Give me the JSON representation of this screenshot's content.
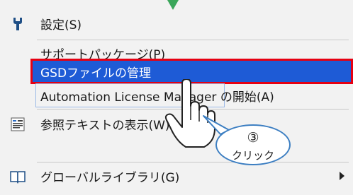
{
  "menu": {
    "items": [
      {
        "label": "設定(S)",
        "icon": "wrench-icon"
      },
      {
        "label": "サポートパッケージ(P)"
      },
      {
        "label": "GSDファイルの管理",
        "selected": true
      },
      {
        "label": "Automation License Manager の開始(A)"
      },
      {
        "label": "参照テキストの表示(W)",
        "icon": "text-document-icon"
      },
      {
        "label": "グローバルライブラリ(G)",
        "icon": "book-icon",
        "submenu": true
      }
    ]
  },
  "callout": {
    "step": "③",
    "text": "クリック"
  },
  "colors": {
    "highlight": "#1e5bd6",
    "highlight_border": "#e60012",
    "callout_border": "#3d7fc2",
    "top_arrow": "#3aa65a"
  }
}
